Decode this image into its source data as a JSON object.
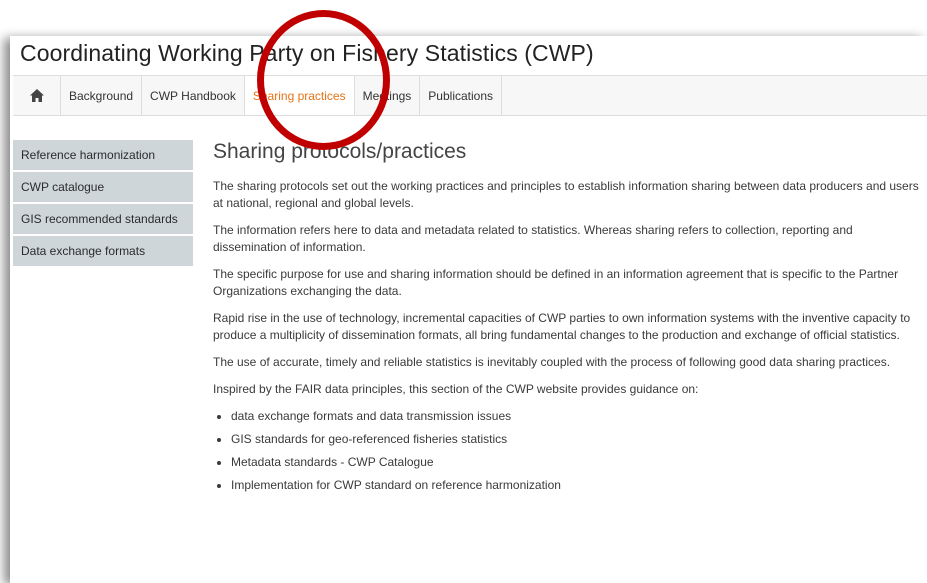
{
  "header": {
    "title": "Coordinating Working Party on Fishery Statistics (CWP)"
  },
  "nav": {
    "home_icon": "home-icon",
    "items": [
      {
        "label": "Background"
      },
      {
        "label": "CWP Handbook"
      },
      {
        "label": "Sharing practices",
        "active": true
      },
      {
        "label": "Meetings"
      },
      {
        "label": "Publications"
      }
    ]
  },
  "sidebar": {
    "items": [
      {
        "label": "Reference harmonization"
      },
      {
        "label": "CWP catalogue"
      },
      {
        "label": "GIS recommended standards"
      },
      {
        "label": "Data exchange formats"
      }
    ]
  },
  "main": {
    "heading": "Sharing protocols/practices",
    "paragraphs": [
      "The sharing protocols set out the working practices and principles to establish information sharing between data producers and users at national, regional and global levels.",
      "The information refers here to data and metadata related to statistics. Whereas sharing refers to collection, reporting and dissemination of information.",
      "The specific purpose for use and sharing information should be defined in an information agreement that is specific to the Partner Organizations exchanging the data.",
      "Rapid rise in the use of technology, incremental capacities of CWP parties to own information systems with the inventive capacity to produce a multiplicity of dissemination formats, all bring fundamental changes to the production and exchange of official statistics.",
      "The use of accurate, timely and reliable statistics is inevitably coupled with the process of following good data sharing practices.",
      "Inspired by the FAIR data principles, this section of the CWP website provides guidance on:"
    ],
    "bullets": [
      "data exchange formats and data transmission issues",
      "GIS standards for geo-referenced fisheries statistics",
      "Metadata standards - CWP Catalogue",
      "Implementation for CWP standard on reference harmonization"
    ]
  },
  "colors": {
    "active_tab": "#e57316",
    "highlight_circle": "#c00000",
    "sidebar_bg": "#cfd6da"
  }
}
